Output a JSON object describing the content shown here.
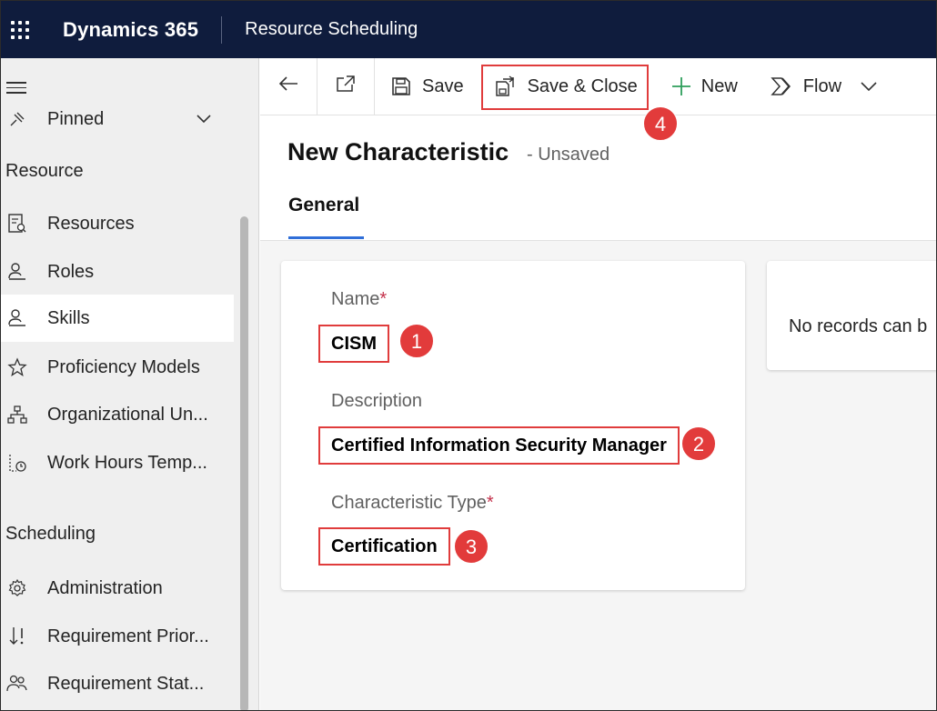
{
  "topbar": {
    "brand": "Dynamics 365",
    "app_name": "Resource Scheduling"
  },
  "sidebar": {
    "pinned_label": "Pinned",
    "resource_header": "Resource",
    "resource_items": [
      {
        "label": "Resources",
        "icon": "resources-icon"
      },
      {
        "label": "Roles",
        "icon": "roles-icon"
      },
      {
        "label": "Skills",
        "icon": "skills-icon",
        "active": true
      },
      {
        "label": "Proficiency Models",
        "icon": "star-icon"
      },
      {
        "label": "Organizational Un...",
        "icon": "org-chart-icon"
      },
      {
        "label": "Work Hours Temp...",
        "icon": "calendar-clock-icon"
      }
    ],
    "scheduling_header": "Scheduling",
    "scheduling_items": [
      {
        "label": "Administration",
        "icon": "gear-icon"
      },
      {
        "label": "Requirement Prior...",
        "icon": "sort-priority-icon"
      },
      {
        "label": "Requirement Stat...",
        "icon": "people-status-icon"
      }
    ]
  },
  "commandbar": {
    "save_label": "Save",
    "save_close_label": "Save & Close",
    "new_label": "New",
    "flow_label": "Flow"
  },
  "form": {
    "title": "New Characteristic",
    "status": "- Unsaved",
    "tab_general": "General",
    "name_label": "Name",
    "name_value": "CISM",
    "description_label": "Description",
    "description_value": "Certified Information Security Manager",
    "type_label": "Characteristic Type",
    "type_value": "Certification",
    "required_mark": "*",
    "side_panel_text": "No records can b"
  },
  "annotations": {
    "step1": "1",
    "step2": "2",
    "step3": "3",
    "step4": "4"
  },
  "colors": {
    "topbar_bg": "#0f1c3d",
    "highlight_red": "#e03c3c",
    "tab_accent": "#2f6ed8",
    "new_plus_green": "#2e9e5b"
  }
}
